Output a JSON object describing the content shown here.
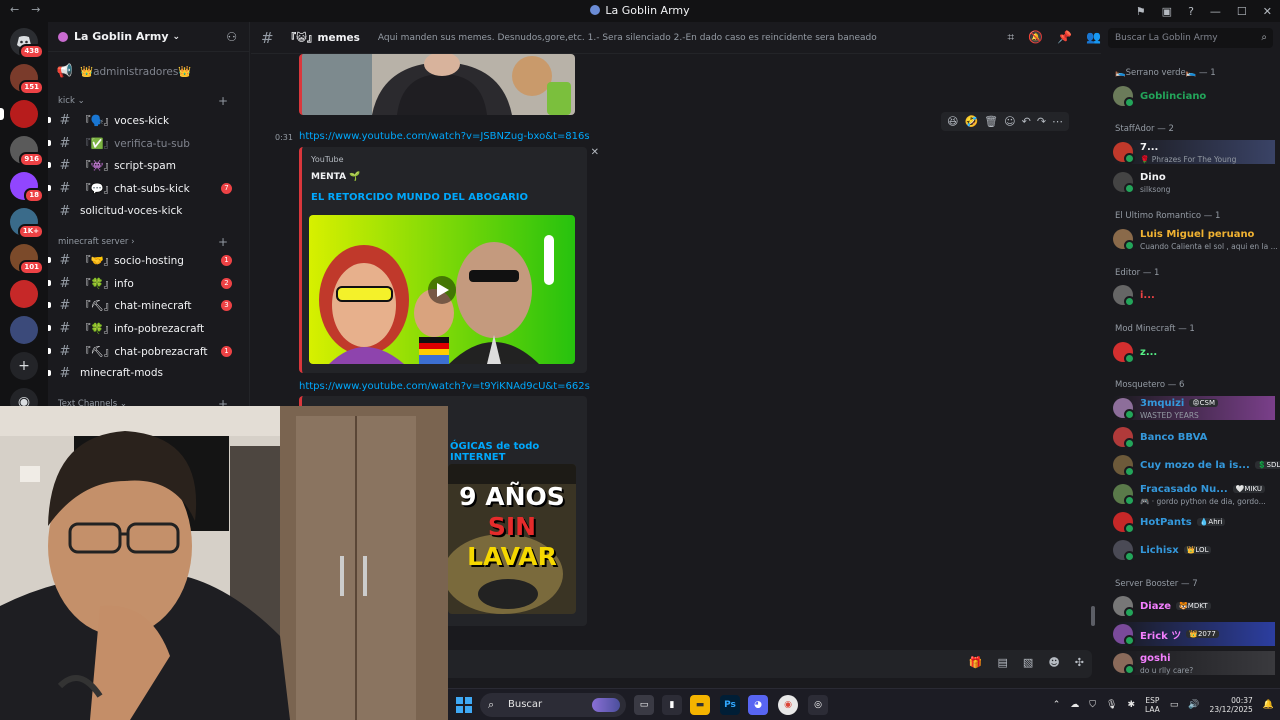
{
  "window": {
    "title": "La Goblin Army"
  },
  "rail": {
    "servers": [
      {
        "badge": "438",
        "color": "#2b2d31",
        "label": ""
      },
      {
        "badge": "151",
        "color": "#7a3b2b",
        "label": ""
      },
      {
        "badge": "",
        "color": "#b71c1c",
        "label": ""
      },
      {
        "badge": "916",
        "color": "#5a5a5a",
        "label": ""
      },
      {
        "badge": "18",
        "color": "#9146ff",
        "label": ""
      },
      {
        "badge": "1K+",
        "color": "#3a6b8a",
        "label": ""
      },
      {
        "badge": "101",
        "color": "#7b4a2a",
        "label": ""
      },
      {
        "badge": "",
        "color": "#c62828",
        "label": ""
      },
      {
        "badge": "",
        "color": "#3b4a7a",
        "label": ""
      }
    ]
  },
  "sidebar": {
    "guild_name": "La Goblin Army",
    "top_channel": "👑administradores👑",
    "cat_kick": "kick",
    "cat_minecraft": "minecraft server",
    "cat_text": "Text Channels",
    "channels": [
      {
        "name": "『🗣️』voces-kick",
        "muted": false,
        "count": ""
      },
      {
        "name": "『✅』verifica-tu-sub",
        "muted": true,
        "count": ""
      },
      {
        "name": "『👾』script-spam",
        "muted": false,
        "count": ""
      },
      {
        "name": "『💬』chat-subs-kick",
        "muted": false,
        "count": "7"
      },
      {
        "name": "solicitud-voces-kick",
        "muted": false,
        "count": ""
      },
      {
        "name": "『🤝』socio-hosting",
        "muted": false,
        "count": "1"
      },
      {
        "name": "『🍀』info",
        "muted": false,
        "count": "2"
      },
      {
        "name": "『⛏』chat-minecraft",
        "muted": false,
        "count": "3"
      },
      {
        "name": "『🍀』info-pobrezacraft",
        "muted": false,
        "count": ""
      },
      {
        "name": "『⛏』chat-pobrezacraft",
        "muted": false,
        "count": "1"
      },
      {
        "name": "minecraft-mods",
        "muted": false,
        "count": ""
      }
    ]
  },
  "chat": {
    "channel_name": "『😺』memes",
    "topic": "Aqui manden sus memes. Desnudos,gore,etc. 1.- Sera silenciado 2.-En dado caso es reincidente sera baneado",
    "timestamp": "0:31",
    "link1": "https://www.youtube.com/watch?v=JSBNZug-bxo&t=816s",
    "embed1": {
      "provider": "YouTube",
      "author": "MENTA 🌱",
      "title": "EL RETORCIDO MUNDO DEL ABOGARIO"
    },
    "link2": "https://www.youtube.com/watch?v=t9YiKNAd9cU&t=662s",
    "embed2": {
      "title_fragment": "ÓGICAS de todo INTERNET",
      "thumb_text1": "9 AÑOS",
      "thumb_text2": "SIN",
      "thumb_text3": "LAVAR"
    },
    "search_placeholder": "Buscar La Goblin Army"
  },
  "members": {
    "groups": [
      {
        "name": "🛌Serrano verde🛌 — 1"
      },
      {
        "name": "StaffAdor — 2"
      },
      {
        "name": "El Ultimo Romantico — 1"
      },
      {
        "name": "Editor — 1"
      },
      {
        "name": "Mod Minecraft — 1"
      },
      {
        "name": "Mosquetero — 6"
      },
      {
        "name": "Server Booster — 7"
      }
    ],
    "list": [
      {
        "name": "Goblinciano",
        "color": "#23a55a",
        "sub": "",
        "tag": ""
      },
      {
        "name": "7...",
        "color": "#f2f3f5",
        "sub": "🌹 Phrazes For The Young",
        "tag": ""
      },
      {
        "name": "Dino",
        "color": "#f2f3f5",
        "sub": "silksong",
        "tag": ""
      },
      {
        "name": "Luis Miguel peruano",
        "color": "#f0b232",
        "sub": "Cuando Calienta el sol , aqui en la ...",
        "tag": ""
      },
      {
        "name": "i...",
        "color": "#ed4245",
        "sub": "",
        "tag": ""
      },
      {
        "name": "z...",
        "color": "#57f287",
        "sub": "",
        "tag": ""
      },
      {
        "name": "3mquizi",
        "color": "#3498db",
        "sub": "WASTED YEARS",
        "tag": "😡CSM"
      },
      {
        "name": "Banco BBVA",
        "color": "#3498db",
        "sub": "",
        "tag": ""
      },
      {
        "name": "Cuy mozo de la is...",
        "color": "#3498db",
        "sub": "",
        "tag": "💲SDLG"
      },
      {
        "name": "Fracasado Nu...",
        "color": "#3498db",
        "sub": "🎮 · gordo python de dia, gordo...",
        "tag": "🤍MIKU"
      },
      {
        "name": "HotPants",
        "color": "#3498db",
        "sub": "",
        "tag": "💧Ahri"
      },
      {
        "name": "Lichisx",
        "color": "#3498db",
        "sub": "",
        "tag": "👑LOL"
      },
      {
        "name": "Diaze",
        "color": "#f47fff",
        "sub": "",
        "tag": "🐯MDKT"
      },
      {
        "name": "Erick ツ",
        "color": "#f47fff",
        "sub": "",
        "tag": "👑2077"
      },
      {
        "name": "goshi",
        "color": "#f47fff",
        "sub": "do u rlly care?",
        "tag": ""
      }
    ]
  },
  "taskbar": {
    "search_label": "Buscar",
    "lang_top": "ESP",
    "lang_bottom": "LAA",
    "time": "00:37",
    "date": "23/12/2025"
  }
}
